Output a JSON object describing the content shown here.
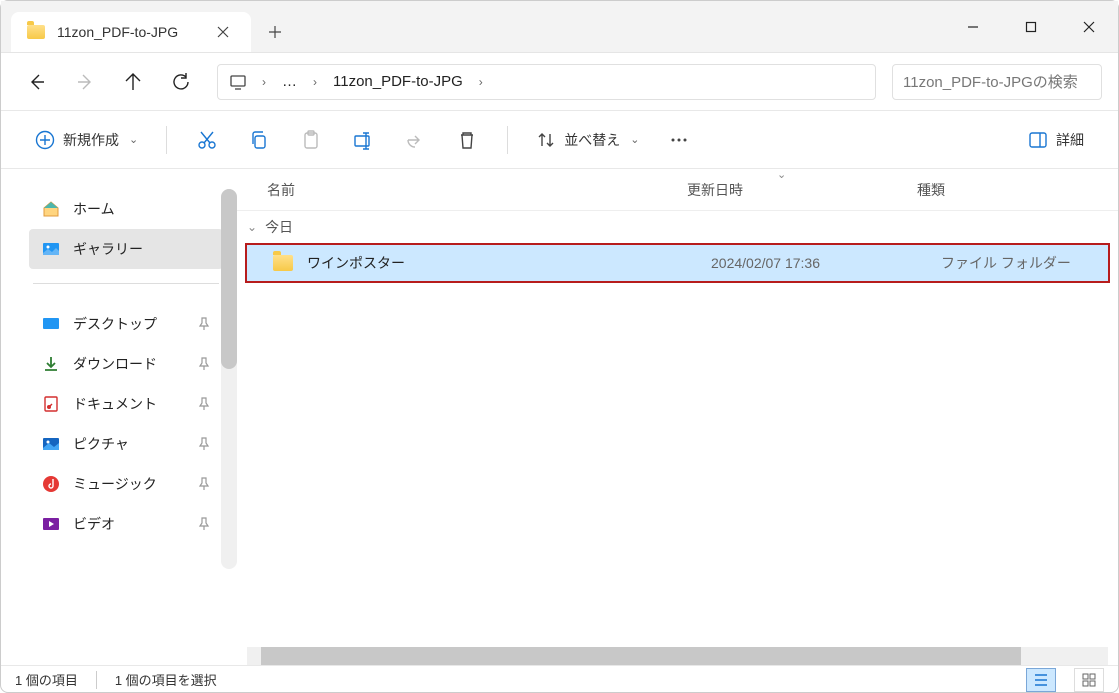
{
  "tab": {
    "title": "11zon_PDF-to-JPG"
  },
  "breadcrumb": {
    "current": "11zon_PDF-to-JPG",
    "more": "…"
  },
  "search": {
    "placeholder": "11zon_PDF-to-JPGの検索"
  },
  "toolbar": {
    "new_label": "新規作成",
    "sort_label": "並べ替え",
    "details_label": "詳細"
  },
  "sidebar": {
    "home": "ホーム",
    "gallery": "ギャラリー",
    "desktop": "デスクトップ",
    "downloads": "ダウンロード",
    "documents": "ドキュメント",
    "pictures": "ピクチャ",
    "music": "ミュージック",
    "videos": "ビデオ"
  },
  "columns": {
    "name": "名前",
    "date": "更新日時",
    "type": "種類"
  },
  "group": {
    "today": "今日"
  },
  "files": [
    {
      "name": "ワインポスター",
      "date": "2024/02/07 17:36",
      "type": "ファイル フォルダー"
    }
  ],
  "status": {
    "count": "1 個の項目",
    "selected": "1 個の項目を選択"
  }
}
